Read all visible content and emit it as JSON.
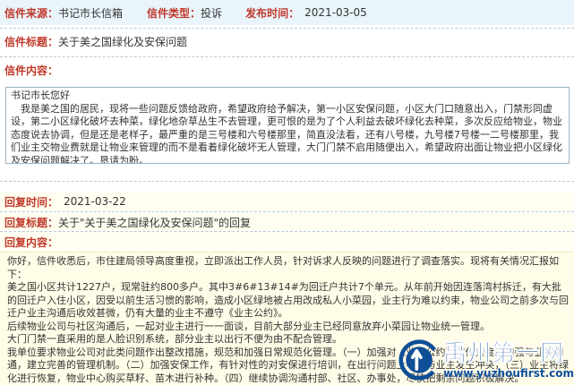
{
  "header": {
    "source_label": "信件来源：",
    "source_value": "书记市长信箱",
    "type_label": "信件类型：",
    "type_value": "投诉",
    "publish_label": "发布时间：",
    "publish_value": "2021-03-05"
  },
  "letter": {
    "title_label": "信件标题：",
    "title_value": "关于美之国绿化及安保问题",
    "content_label": "信件内容：",
    "content_text": "书记市长您好\n　我是美之国的居民，现将一些问题反馈给政府，希望政府给予解决，第一小区安保问题，小区大门口随意出入，门禁形同虚设，第二小区绿化破坏去种菜，绿化地杂草丛生不去管理，更可恨的是为了个人利益去破坏绿化去种菜，多次反应给物业，物业态度说去协调，但是还是老样子，最严重的是三号楼和六号楼那里，简直没法看，还有八号楼，九号楼7号楼一二号楼那里，我们业主交物业费就是让物业来管理的而不是看着绿化破坏无人管理，大门门禁不启用随便出入，希望政府出面让物业把小区绿化及安保问题解决了。恳请为盼。"
  },
  "reply": {
    "time_label": "回复时间：",
    "time_value": "2021-03-22",
    "title_label": "回复标题：",
    "title_value": "关于\"关于美之国绿化及安保问题\"的回复",
    "content_label": "回复内容：",
    "paragraphs": [
      "你好，信件收悉后，市住建局领导高度重视，立即派出工作人员，针对诉求人反映的问题进行了调查落实。现将有关情况汇报如下：",
      "美之国小区共计1227户，现常驻约800多户。其中3#6#13#14#为回迁户共计7个单元。从年前开始因连落湾村拆迁，有大批的回迁户入住小区，因受以前生活习惯的影响，造成小区绿地被占用改成私人小菜园，业主行为难以约束，物业公司之前多次与回迁户业主沟通后收效甚微，仍有大量的业主不遵守《业主公约》。",
      "后续物业公司与社区沟通后，一起对业主进行一一面谈，目前大部分业主已经同意放弃小菜园让物业统一管理。",
      "大门门禁一直采用的是人脸识别系统，部分业主以出行不便为由不配合管理。",
      "我单位要求物业公司对此类问题作出整改措施，规范和加强日常规范化管理。（一）加强对《业主公约》宣传力度，加强与业主沟通，建立完善的管理机制。（二）加强安保工作，有针对性的对安保进行培训，在出行问题上不能与业主发生冲突，（三）业主将绿化进行恢复，物业中心购买草籽、苗木进行补种。（四）继续协调沟通村部、社区、办事处，尽快把剩余问题积极解决。"
    ]
  },
  "watermark": {
    "title": "禹州第一网",
    "url": "www.yuzhoufirst.com"
  }
}
